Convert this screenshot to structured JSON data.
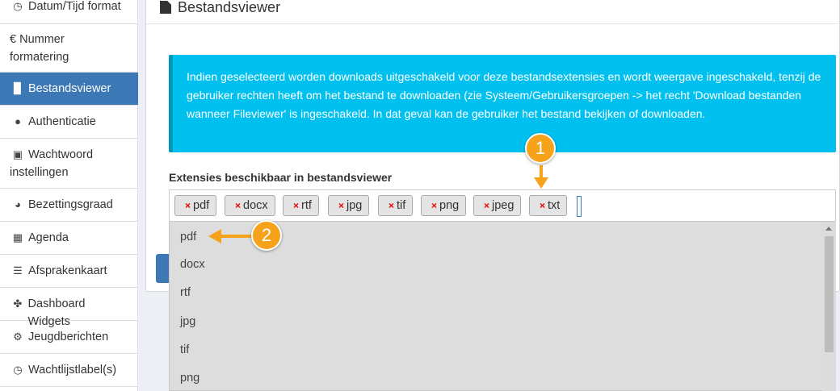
{
  "sidebar": {
    "items": [
      {
        "label": "Datum/Tijd format",
        "icon": "clock-icon",
        "glyph": "◷",
        "active": false
      },
      {
        "label": "€ Nummer formatering",
        "icon": "euro-icon",
        "glyph": "",
        "active": false
      },
      {
        "label": "Bestandsviewer",
        "icon": "file-icon",
        "glyph": "▉",
        "active": true
      },
      {
        "label": "Authenticatie",
        "icon": "user-icon",
        "glyph": "👤",
        "active": false
      },
      {
        "label": "Wachtwoord instellingen",
        "icon": "lock-icon",
        "glyph": "🔒",
        "active": false
      },
      {
        "label": "Bezettingsgraad",
        "icon": "pie-chart-icon",
        "glyph": "◕",
        "active": false
      },
      {
        "label": "Agenda",
        "icon": "calendar-icon",
        "glyph": "▦",
        "active": false
      },
      {
        "label": "Afsprakenkaart",
        "icon": "list-icon",
        "glyph": "☰",
        "active": false
      },
      {
        "label": "Dashboard Widgets",
        "icon": "puzzle-icon",
        "glyph": "✤",
        "active": false
      },
      {
        "label": "Jeugdberichten",
        "icon": "gear-icon",
        "glyph": "⚙",
        "active": false
      },
      {
        "label": "Wachtlijstlabel(s)",
        "icon": "clock-icon",
        "glyph": "◷",
        "active": false
      }
    ]
  },
  "panel": {
    "title": "Bestandsviewer",
    "info": "Indien geselecteerd worden downloads uitgeschakeld voor deze bestandsextensies en wordt weergave ingeschakeld, tenzij de gebruiker rechten heeft om het bestand te downloaden (zie Systeem/Gebruikersgroepen -> het recht 'Download bestanden wanneer Fileviewer' is ingeschakeld. In dat geval kan de gebruiker het bestand bekijken of downloaden.",
    "field_label": "Extensies beschikbaar in bestandsviewer",
    "tags": [
      "pdf",
      "docx",
      "rtf",
      "jpg",
      "tif",
      "png",
      "jpeg",
      "txt"
    ],
    "remove_glyph": "×"
  },
  "dropdown": {
    "options": [
      "pdf",
      "docx",
      "rtf",
      "jpg",
      "tif",
      "png"
    ]
  },
  "callouts": [
    {
      "number": "1"
    },
    {
      "number": "2"
    }
  ],
  "colors": {
    "accent": "#3c78b5",
    "info": "#00c0ef",
    "callout": "#f6a21a"
  }
}
